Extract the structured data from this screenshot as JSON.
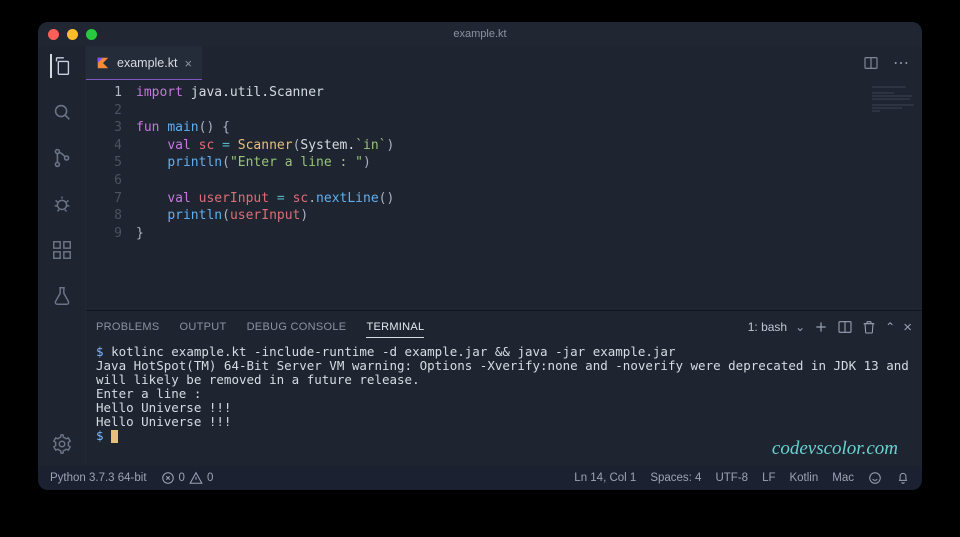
{
  "title": "example.kt",
  "tab": {
    "label": "example.kt"
  },
  "code": {
    "lines": [
      {
        "n": 1,
        "tokens": [
          [
            "kw",
            "import"
          ],
          [
            "sp",
            " "
          ],
          [
            "ns",
            "java.util.Scanner"
          ]
        ]
      },
      {
        "n": 2,
        "tokens": []
      },
      {
        "n": 3,
        "tokens": [
          [
            "kw",
            "fun"
          ],
          [
            "sp",
            " "
          ],
          [
            "fn",
            "main"
          ],
          [
            "punc",
            "()"
          ],
          [
            "sp",
            " "
          ],
          [
            "punc",
            "{"
          ]
        ]
      },
      {
        "n": 4,
        "tokens": [
          [
            "sp",
            "    "
          ],
          [
            "kw",
            "val"
          ],
          [
            "sp",
            " "
          ],
          [
            "var",
            "sc"
          ],
          [
            "sp",
            " "
          ],
          [
            "op",
            "="
          ],
          [
            "sp",
            " "
          ],
          [
            "type",
            "Scanner"
          ],
          [
            "punc",
            "("
          ],
          [
            "ns",
            "System."
          ],
          [
            "str",
            "`in`"
          ],
          [
            "punc",
            ")"
          ]
        ]
      },
      {
        "n": 5,
        "tokens": [
          [
            "sp",
            "    "
          ],
          [
            "fn",
            "println"
          ],
          [
            "punc",
            "("
          ],
          [
            "str",
            "\"Enter a line : \""
          ],
          [
            "punc",
            ")"
          ]
        ]
      },
      {
        "n": 6,
        "tokens": []
      },
      {
        "n": 7,
        "tokens": [
          [
            "sp",
            "    "
          ],
          [
            "kw",
            "val"
          ],
          [
            "sp",
            " "
          ],
          [
            "var",
            "userInput"
          ],
          [
            "sp",
            " "
          ],
          [
            "op",
            "="
          ],
          [
            "sp",
            " "
          ],
          [
            "var",
            "sc"
          ],
          [
            "punc",
            "."
          ],
          [
            "fn",
            "nextLine"
          ],
          [
            "punc",
            "()"
          ]
        ]
      },
      {
        "n": 8,
        "tokens": [
          [
            "sp",
            "    "
          ],
          [
            "fn",
            "println"
          ],
          [
            "punc",
            "("
          ],
          [
            "var",
            "userInput"
          ],
          [
            "punc",
            ")"
          ]
        ]
      },
      {
        "n": 9,
        "tokens": [
          [
            "punc",
            "}"
          ]
        ]
      }
    ]
  },
  "panel": {
    "tabs": {
      "problems": "PROBLEMS",
      "output": "OUTPUT",
      "debug": "DEBUG CONSOLE",
      "terminal": "TERMINAL"
    },
    "terminal_select": "1: bash",
    "terminal_lines": [
      "$ kotlinc example.kt -include-runtime -d example.jar && java -jar example.jar",
      "Java HotSpot(TM) 64-Bit Server VM warning: Options -Xverify:none and -noverify were deprecated in JDK 13 and will likely be removed in a future release.",
      "Enter a line :",
      "Hello Universe !!!",
      "Hello Universe !!!",
      "$ "
    ]
  },
  "status": {
    "python": "Python 3.7.3 64-bit",
    "err": "0",
    "warn": "0",
    "lncol": "Ln 14, Col 1",
    "spaces": "Spaces: 4",
    "enc": "UTF-8",
    "eol": "LF",
    "lang": "Kotlin",
    "os": "Mac"
  },
  "watermark": "codevscolor.com"
}
